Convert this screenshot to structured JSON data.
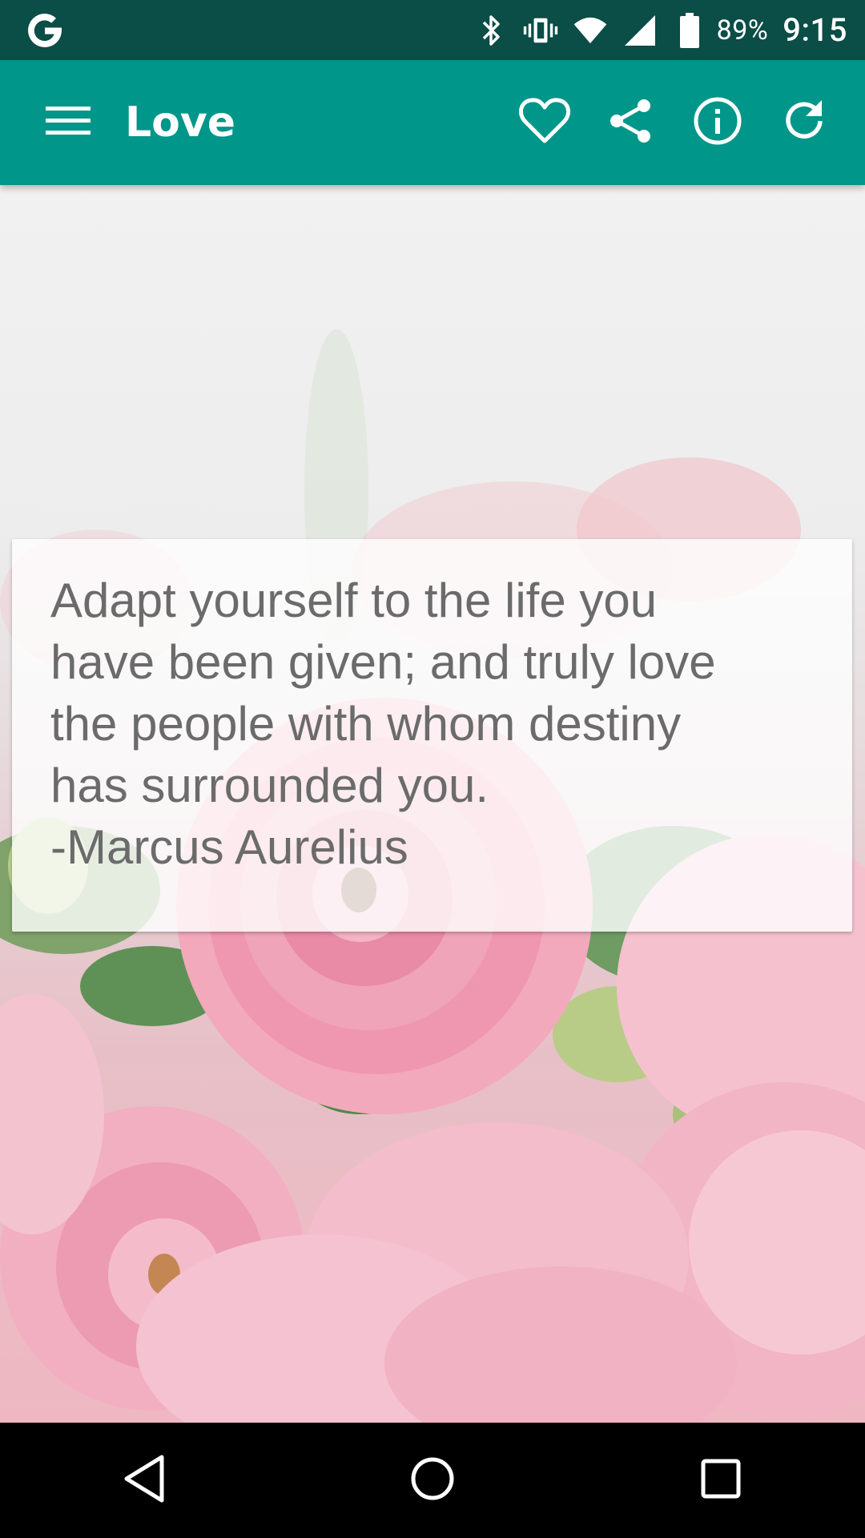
{
  "status_bar": {
    "left_icon": "google-g-icon",
    "icons": [
      "bluetooth-icon",
      "vibrate-icon",
      "wifi-icon",
      "cell-signal-icon",
      "battery-icon"
    ],
    "battery_percent": "89%",
    "time": "9:15",
    "background_color": "#0b4d47"
  },
  "app_bar": {
    "menu_icon": "hamburger-menu-icon",
    "title": "Love",
    "actions": [
      "heart-icon",
      "share-icon",
      "info-icon",
      "refresh-icon"
    ],
    "background_color": "#00968a"
  },
  "quote": {
    "text": "Adapt yourself to the life you\nhave been given; and truly love\nthe people with whom destiny\nhas surrounded you.\n-Marcus Aurelius"
  },
  "background": {
    "image_subject": "pink ranunculus flowers"
  },
  "nav_bar": {
    "buttons": [
      "back-icon",
      "home-icon",
      "recents-icon"
    ]
  }
}
